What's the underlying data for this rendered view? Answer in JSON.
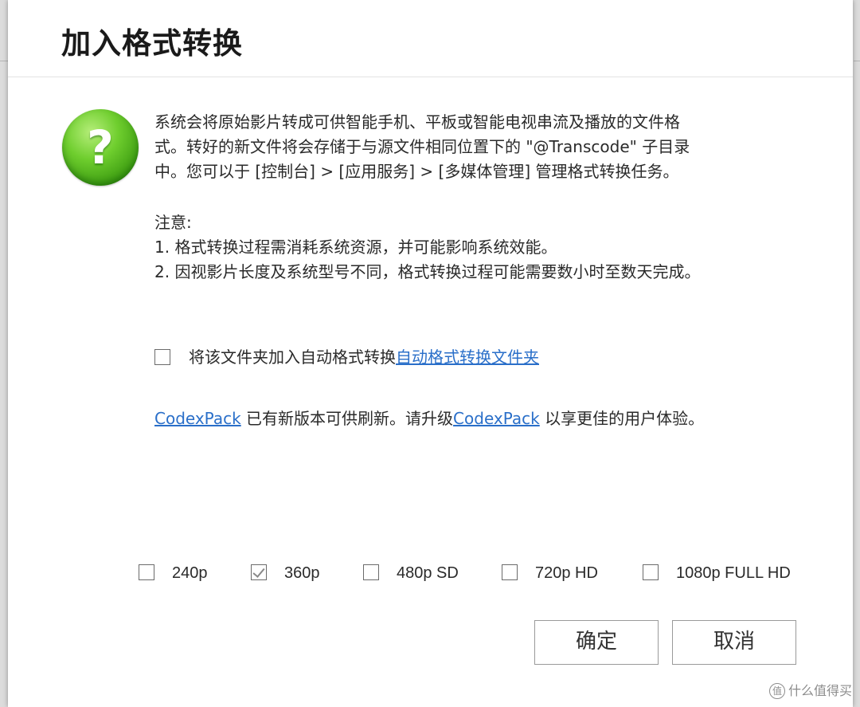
{
  "dialog": {
    "title": "加入格式转换",
    "icon": "question-mark-icon",
    "intro_lines": [
      "系统会将原始影片转成可供智能手机、平板或智能电视串流及播放的文件格",
      "式。转好的新文件将会存储于与源文件相同位置下的 \"@Transcode\" 子目录",
      "中。您可以于 [控制台] > [应用服务] > [多媒体管理] 管理格式转换任务。"
    ],
    "notes_lines": [
      "注意:",
      "1. 格式转换过程需消耗系统资源，并可能影响系统效能。",
      "2. 因视影片长度及系统型号不同，格式转换过程可能需要数小时至数天完成。"
    ],
    "auto_transcode": {
      "checked": false,
      "label": "将该文件夹加入自动格式转换",
      "link": "自动格式转换文件夹"
    },
    "codexpack": {
      "link1": "CodexPack",
      "text1": " 已有新版本可供刷新。请升级",
      "link2": "CodexPack",
      "text2": " 以享更佳的用户体验。"
    },
    "resolutions": [
      {
        "label": "240p",
        "checked": false
      },
      {
        "label": "360p",
        "checked": true
      },
      {
        "label": "480p SD",
        "checked": false
      },
      {
        "label": "720p HD",
        "checked": false
      },
      {
        "label": "1080p FULL HD",
        "checked": false
      }
    ],
    "buttons": {
      "ok": "确定",
      "cancel": "取消"
    }
  },
  "watermark": {
    "icon_glyph": "值",
    "text": "什么值得买"
  }
}
